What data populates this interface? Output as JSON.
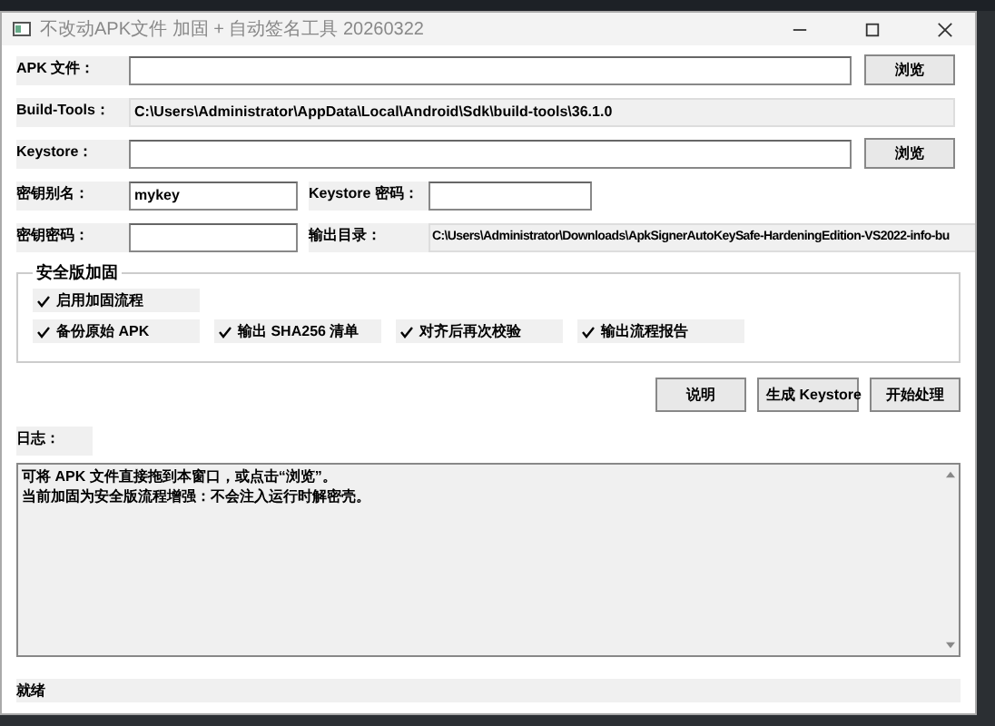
{
  "window": {
    "title": "不改动APK文件 加固 + 自动签名工具 20260322"
  },
  "fields": [
    {
      "kind": "browse",
      "label": "APK 文件：",
      "button": "浏览"
    },
    {
      "kind": "readonly",
      "label": "Build-Tools：",
      "value": "C:\\Users\\Administrator\\AppData\\Local\\Android\\Sdk\\build-tools\\36.1.0"
    },
    {
      "kind": "browse",
      "label": "Keystore：",
      "button": "浏览"
    }
  ],
  "pairs": [
    [
      {
        "label": "密钥别名：",
        "value": "mykey",
        "kind": "input"
      },
      {
        "label": "Keystore 密码：",
        "kind": "input"
      }
    ],
    [
      {
        "label": "密钥密码：",
        "kind": "input"
      },
      {
        "label": "输出目录：",
        "value": "C:\\Users\\Administrator\\Downloads\\ApkSignerAutoKeySafe-HardeningEdition-VS2022-info-bu",
        "kind": "readonly"
      }
    ]
  ],
  "group": {
    "title": "安全版加固",
    "rows": [
      [
        {
          "label": "启用加固流程",
          "checked": true
        }
      ],
      [
        {
          "label": "备份原始 APK",
          "checked": true
        },
        {
          "label": "输出 SHA256 清单",
          "checked": true
        },
        {
          "label": "对齐后再次校验",
          "checked": true
        },
        {
          "label": "输出流程报告",
          "checked": true
        }
      ]
    ]
  },
  "buttons": [
    "说明",
    "生成 Keystore",
    "开始处理"
  ],
  "log": {
    "label": "日志：",
    "lines": [
      "可将 APK 文件直接拖到本窗口，或点击“浏览”。",
      "当前加固为安全版流程增强：不会注入运行时解密壳。"
    ]
  },
  "status_bar": "就绪"
}
